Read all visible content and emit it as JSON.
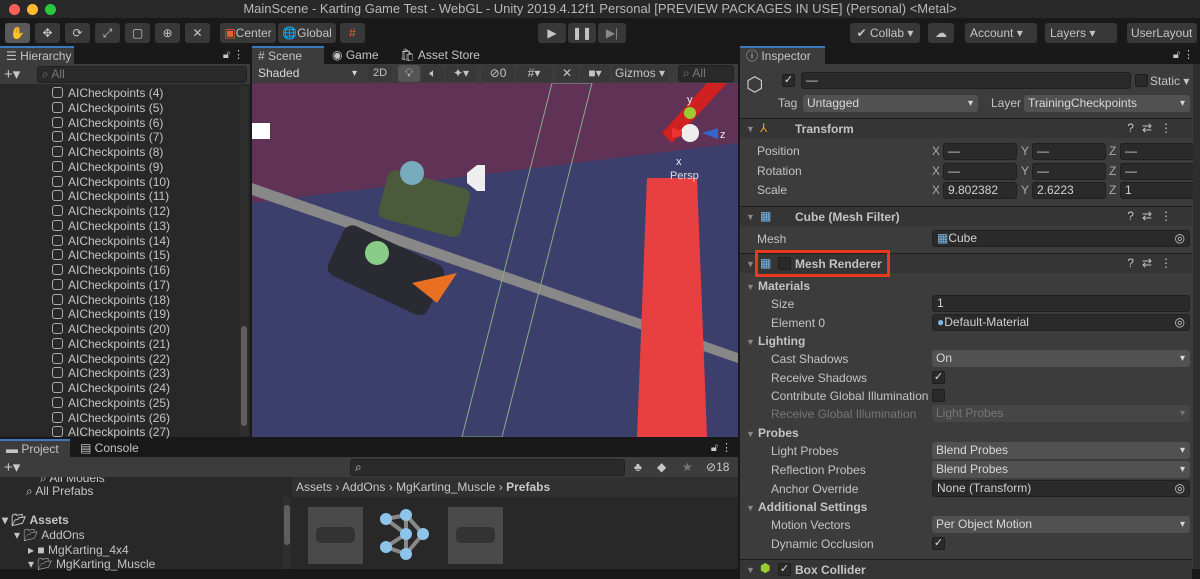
{
  "window": {
    "title": "MainScene - Karting Game Test - WebGL - Unity 2019.4.12f1 Personal [PREVIEW PACKAGES IN USE] (Personal) <Metal>"
  },
  "toolbar": {
    "center": "Center",
    "global": "Global",
    "collab": "Collab",
    "account": "Account",
    "layers": "Layers",
    "layout": "UserLayout"
  },
  "hierarchy": {
    "title": "Hierarchy",
    "search_placeholder": "All",
    "items": [
      "AICheckpoints (4)",
      "AICheckpoints (5)",
      "AICheckpoints (6)",
      "AICheckpoints (7)",
      "AICheckpoints (8)",
      "AICheckpoints (9)",
      "AICheckpoints (10)",
      "AICheckpoints (11)",
      "AICheckpoints (12)",
      "AICheckpoints (13)",
      "AICheckpoints (14)",
      "AICheckpoints (15)",
      "AICheckpoints (16)",
      "AICheckpoints (17)",
      "AICheckpoints (18)",
      "AICheckpoints (19)",
      "AICheckpoints (20)",
      "AICheckpoints (21)",
      "AICheckpoints (22)",
      "AICheckpoints (23)",
      "AICheckpoints (24)",
      "AICheckpoints (25)",
      "AICheckpoints (26)",
      "AICheckpoints (27)"
    ]
  },
  "scene": {
    "tabs": [
      "Scene",
      "Game",
      "Asset Store"
    ],
    "shading": "Shaded",
    "mode2d": "2D",
    "hidden_count": "0",
    "gizmos": "Gizmos",
    "search_placeholder": "All",
    "persp": "Persp",
    "axis_y": "y",
    "axis_z": "z",
    "axis_x": "x"
  },
  "project": {
    "tabs": [
      "Project",
      "Console"
    ],
    "hidden_count": "18",
    "favorites": [
      "All Models",
      "All Prefabs"
    ],
    "tree": [
      {
        "label": "Assets",
        "level": 0
      },
      {
        "label": "AddOns",
        "level": 1
      },
      {
        "label": "MgKarting_4x4",
        "level": 2
      },
      {
        "label": "MgKarting_Muscle",
        "level": 2
      }
    ],
    "breadcrumb": [
      "Assets",
      "AddOns",
      "MgKarting_Muscle",
      "Prefabs"
    ]
  },
  "inspector": {
    "title": "Inspector",
    "name": "—",
    "static": "Static",
    "tag_label": "Tag",
    "tag": "Untagged",
    "layer_label": "Layer",
    "layer": "TrainingCheckpoints",
    "transform": {
      "title": "Transform",
      "rows": [
        {
          "label": "Position",
          "x": "—",
          "y": "—",
          "z": "—"
        },
        {
          "label": "Rotation",
          "x": "—",
          "y": "—",
          "z": "—"
        },
        {
          "label": "Scale",
          "x": "9.802382",
          "y": "2.6223",
          "z": "1"
        }
      ]
    },
    "mesh_filter": {
      "title": "Cube (Mesh Filter)",
      "mesh_label": "Mesh",
      "mesh": "Cube"
    },
    "mesh_renderer": {
      "title": "Mesh Renderer",
      "enabled": false,
      "materials": "Materials",
      "size_label": "Size",
      "size": "1",
      "element0_label": "Element 0",
      "element0": "Default-Material",
      "lighting": "Lighting",
      "cast_shadows_label": "Cast Shadows",
      "cast_shadows": "On",
      "receive_shadows_label": "Receive Shadows",
      "receive_shadows": true,
      "contribute_gi_label": "Contribute Global Illumination",
      "contribute_gi": false,
      "receive_gi_label": "Receive Global Illumination",
      "receive_gi": "Light Probes",
      "probes": "Probes",
      "light_probes_label": "Light Probes",
      "light_probes": "Blend Probes",
      "reflection_probes_label": "Reflection Probes",
      "reflection_probes": "Blend Probes",
      "anchor_label": "Anchor Override",
      "anchor": "None (Transform)",
      "additional": "Additional Settings",
      "motion_vectors_label": "Motion Vectors",
      "motion_vectors": "Per Object Motion",
      "dynamic_occlusion_label": "Dynamic Occlusion",
      "dynamic_occlusion": true
    },
    "box_collider": {
      "title": "Box Collider"
    }
  },
  "colors": {
    "highlight": "#e8391f",
    "accent": "#3a79bb",
    "scene_bg": "#3a3f6e",
    "checkpoint": "#e84040"
  }
}
